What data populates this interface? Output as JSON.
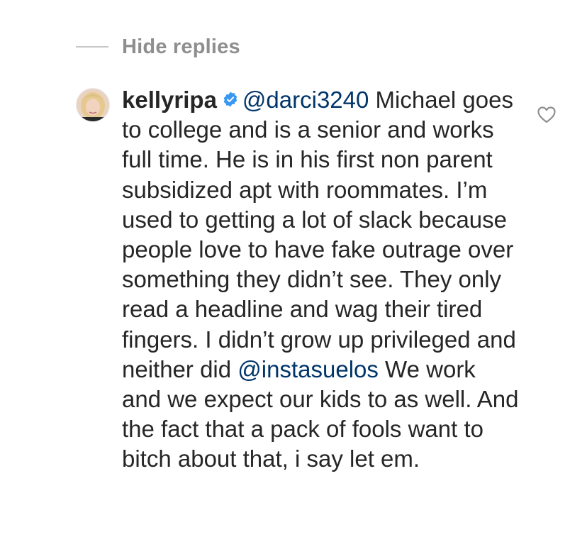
{
  "replies_toggle": {
    "label": "Hide replies"
  },
  "reply": {
    "username": "kellyripa",
    "verified": true,
    "mention_1": "@darci3240",
    "text_1": " Michael goes to college and is a senior and works full time. He is in his first non parent subsidized apt with roommates. I’m used to getting a lot of slack because people love to have fake outrage over something they didn’t see. They only read a headline and wag their tired fingers. I didn’t grow up privileged and neither did ",
    "mention_2": "@instasuelos",
    "text_2": " We work and we expect our kids to as well. And the fact that a pack of fools want to bitch about that, i say let em."
  },
  "icons": {
    "avatar": "avatar",
    "verified": "verified-badge-icon",
    "like": "heart-outline-icon"
  },
  "colors": {
    "text": "#262626",
    "muted": "#8e8e8e",
    "mention": "#003569",
    "verified": "#3897f0"
  }
}
